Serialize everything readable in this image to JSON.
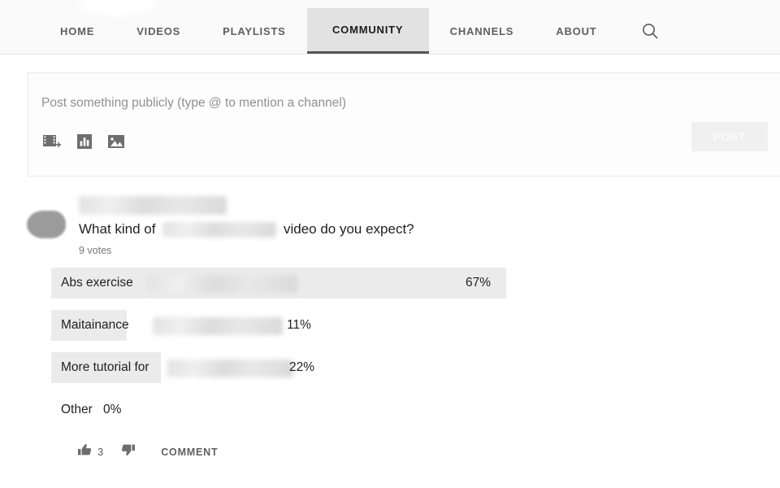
{
  "nav": {
    "tabs": [
      {
        "label": "HOME",
        "active": false
      },
      {
        "label": "VIDEOS",
        "active": false
      },
      {
        "label": "PLAYLISTS",
        "active": false
      },
      {
        "label": "COMMUNITY",
        "active": true
      },
      {
        "label": "CHANNELS",
        "active": false
      },
      {
        "label": "ABOUT",
        "active": false
      }
    ],
    "search_icon": "search-icon",
    "active_tab_bg": "#e2e2e2",
    "active_tab_underline": "#565656"
  },
  "composer": {
    "placeholder": "Post something publicly (type @ to mention a channel)",
    "post_label": "POST",
    "post_enabled": false,
    "icons": [
      {
        "name": "video-add-icon"
      },
      {
        "name": "poll-bar-chart-icon"
      },
      {
        "name": "image-icon"
      }
    ]
  },
  "post": {
    "author_redacted": true,
    "question_prefix": "What kind of",
    "question_suffix": "video do you expect?",
    "votes": "9 votes",
    "likes": "3",
    "comment_label": "COMMENT",
    "like_icon": "thumbs-up-icon",
    "dislike_icon": "thumbs-down-icon"
  },
  "chart_data": {
    "type": "bar",
    "title": "What kind of [redacted] video do you expect?",
    "subtitle": "9 votes",
    "categories": [
      "Abs exercise",
      "Maitainance",
      "More tutorial for",
      "Other"
    ],
    "values": [
      67,
      11,
      22,
      0
    ],
    "value_labels": [
      "67%",
      "11%",
      "22%",
      "0%"
    ],
    "xlabel": "",
    "ylabel": "",
    "ylim": [
      0,
      100
    ],
    "orientation": "horizontal",
    "legend": "none",
    "grid": false,
    "track_color": "#e6e6e6",
    "fill_color": "#ebebeb",
    "bar_pixel_widths": [
      560,
      93,
      135,
      0
    ],
    "track_pixel_widths": [
      560,
      93,
      135,
      0
    ],
    "redaction_pixel": [
      {
        "left": 118,
        "width": 185
      },
      {
        "left": 125,
        "width": 160
      },
      {
        "left": 143,
        "width": 155
      },
      {
        "left": 0,
        "width": 0
      }
    ]
  }
}
